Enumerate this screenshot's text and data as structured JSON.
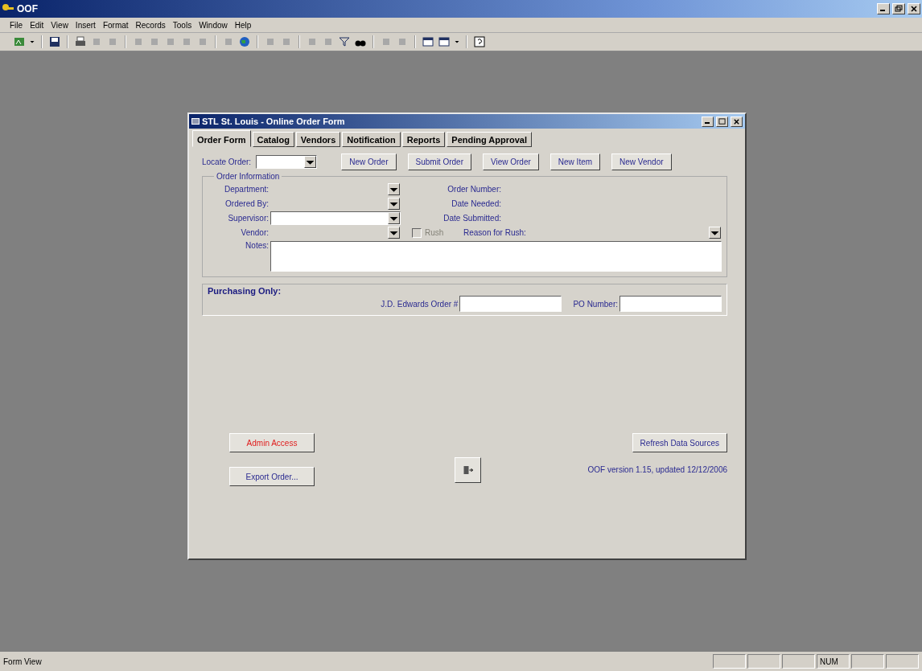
{
  "app_window": {
    "title": "OOF"
  },
  "menu": [
    "File",
    "Edit",
    "View",
    "Insert",
    "Format",
    "Records",
    "Tools",
    "Window",
    "Help"
  ],
  "form_window": {
    "title": "STL St. Louis - Online Order Form"
  },
  "tabs": [
    {
      "label": "Order Form",
      "selected": true
    },
    {
      "label": "Catalog",
      "selected": false
    },
    {
      "label": "Vendors",
      "selected": false
    },
    {
      "label": "Notification",
      "selected": false
    },
    {
      "label": "Reports",
      "selected": false
    },
    {
      "label": "Pending Approval",
      "selected": false
    }
  ],
  "locate_order": {
    "label": "Locate Order:"
  },
  "actions": [
    "New Order",
    "Submit Order",
    "View Order",
    "New Item",
    "New Vendor"
  ],
  "order_information": {
    "legend": "Order Information",
    "fields": [
      {
        "label": "Department:",
        "disabled": true
      },
      {
        "label": "Ordered By:",
        "disabled": true
      },
      {
        "label": "Supervisor:",
        "disabled": false
      },
      {
        "label": "Vendor:",
        "disabled": true
      }
    ],
    "info_labels": [
      "Order Number:",
      "Date Needed:",
      "Date Submitted:"
    ],
    "rush": {
      "label": "Rush",
      "checked": false,
      "disabled": true
    },
    "reason": {
      "label": "Reason for Rush:"
    },
    "notes": {
      "label": "Notes:"
    }
  },
  "purchasing": {
    "heading": "Purchasing Only:",
    "jde_label": "J.D. Edwards Order #",
    "po_label": "PO Number:"
  },
  "bottom": {
    "admin": "Admin Access",
    "export": "Export Order...",
    "refresh": "Refresh Data Sources",
    "version": "OOF version 1.15, updated 12/12/2006"
  },
  "status_bar": {
    "left": "Form View",
    "indicator": "NUM"
  }
}
